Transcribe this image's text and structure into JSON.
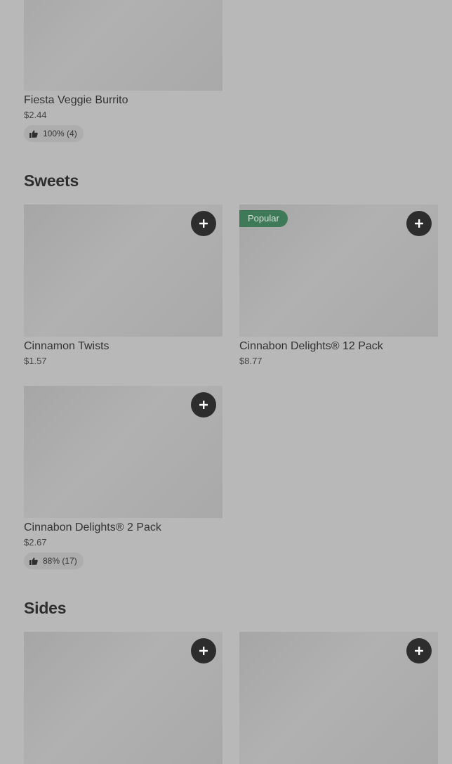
{
  "sections": [
    {
      "title": "",
      "items": [
        {
          "name": "Fiesta Veggie Burrito",
          "price": "$2.44",
          "rating": "100% (4)"
        }
      ]
    },
    {
      "title": "Sweets",
      "items": [
        {
          "name": "Cinnamon Twists",
          "price": "$1.57"
        },
        {
          "name": "Cinnabon Delights® 12 Pack",
          "price": "$8.77",
          "badge": "Popular"
        },
        {
          "name": "Cinnabon Delights® 2 Pack",
          "price": "$2.67",
          "rating": "88% (17)"
        }
      ]
    },
    {
      "title": "Sides",
      "items": [
        {
          "name": "",
          "price": ""
        },
        {
          "name": "",
          "price": ""
        }
      ]
    }
  ],
  "icons": {
    "add": "plus-icon",
    "rating": "thumbs-up-icon"
  },
  "colors": {
    "background": "#b8b8b8",
    "badge": "#3e7a57",
    "add_button": "#2d2d2d"
  }
}
